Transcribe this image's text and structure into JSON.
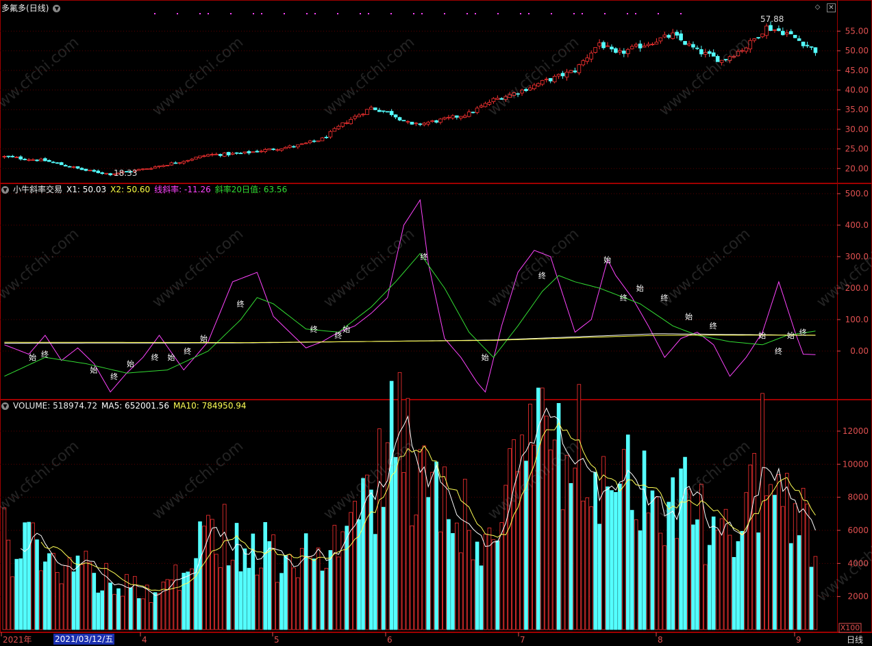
{
  "app": {
    "stock_title": "多氟多",
    "period": "(日线)",
    "period_bottom": "日线",
    "vol_unit": "X100"
  },
  "colors": {
    "background": "#000000",
    "up": "#ff3333",
    "down": "#54ffff",
    "grid": "#5a0000",
    "border": "#a00000",
    "axis_text": "#e05050",
    "ma5": "#ffffff",
    "ma10": "#ffff55",
    "slope_line": "#ff44ff",
    "slope_ma20": "#33dd33",
    "x1_line": "#ffffff",
    "x2_line": "#ffff44",
    "signal_marks": "#ff44ff"
  },
  "panels": {
    "price": {
      "high_label": "57.88",
      "low_label": "18.33",
      "yticks": [
        "55.00",
        "50.00",
        "45.00",
        "40.00",
        "35.00",
        "30.00",
        "25.00",
        "20.00"
      ]
    },
    "indicator": {
      "name": "小牛斜率交易",
      "x1_label": "X1: 50.03",
      "x2_label": "X2: 50.60",
      "slope_label": "线斜率: -11.26",
      "ma20_label": "斜率20日值: 63.56",
      "yticks": [
        "500.0",
        "400.0",
        "300.0",
        "200.0",
        "100.0",
        "0.00"
      ],
      "start_label": "始",
      "end_label": "终"
    },
    "volume": {
      "vol_label": "VOLUME: 518974.72",
      "ma5_label": "MA5: 652001.56",
      "ma10_label": "MA10: 784950.94",
      "yticks": [
        "12000",
        "10000",
        "8000",
        "6000",
        "4000",
        "2000"
      ]
    }
  },
  "x_axis": {
    "labels": [
      "2021年",
      "4",
      "5",
      "6",
      "7",
      "8",
      "9"
    ],
    "selected_date": "2021/03/12/五"
  },
  "watermark": "www.cfchi.com",
  "chart_data": [
    {
      "type": "candlestick",
      "title": "多氟多(日线)",
      "ylim": [
        17,
        58
      ],
      "x_range": [
        "2021-03",
        "2021-09"
      ],
      "price_keypoints": [
        {
          "bar": 0,
          "close": 23.0
        },
        {
          "bar": 10,
          "close": 22.0
        },
        {
          "bar": 20,
          "close": 19.5
        },
        {
          "bar": 26,
          "close": 18.6
        },
        {
          "bar": 34,
          "close": 19.8
        },
        {
          "bar": 42,
          "close": 21.5
        },
        {
          "bar": 50,
          "close": 23.5
        },
        {
          "bar": 58,
          "close": 23.8
        },
        {
          "bar": 66,
          "close": 25.0
        },
        {
          "bar": 72,
          "close": 25.8
        },
        {
          "bar": 78,
          "close": 27.5
        },
        {
          "bar": 84,
          "close": 32.0
        },
        {
          "bar": 90,
          "close": 35.5
        },
        {
          "bar": 95,
          "close": 34.0
        },
        {
          "bar": 100,
          "close": 31.0
        },
        {
          "bar": 108,
          "close": 32.5
        },
        {
          "bar": 114,
          "close": 34.0
        },
        {
          "bar": 120,
          "close": 37.5
        },
        {
          "bar": 126,
          "close": 39.5
        },
        {
          "bar": 132,
          "close": 42.0
        },
        {
          "bar": 140,
          "close": 45.0
        },
        {
          "bar": 146,
          "close": 52.0
        },
        {
          "bar": 150,
          "close": 49.0
        },
        {
          "bar": 158,
          "close": 52.0
        },
        {
          "bar": 164,
          "close": 54.0
        },
        {
          "bar": 170,
          "close": 50.0
        },
        {
          "bar": 176,
          "close": 47.5
        },
        {
          "bar": 182,
          "close": 51.0
        },
        {
          "bar": 187,
          "close": 56.0
        },
        {
          "bar": 192,
          "close": 54.5
        },
        {
          "bar": 196,
          "close": 52.0
        },
        {
          "bar": 199,
          "close": 50.0
        }
      ],
      "highest": 57.88,
      "lowest": 18.33
    },
    {
      "type": "line",
      "title": "小牛斜率交易",
      "ylim": [
        -150,
        520
      ],
      "series": [
        {
          "name": "线斜率",
          "color": "#ff44ff",
          "keypoints": [
            [
              0,
              20
            ],
            [
              6,
              -10
            ],
            [
              10,
              50
            ],
            [
              14,
              -30
            ],
            [
              18,
              10
            ],
            [
              22,
              -40
            ],
            [
              26,
              -130
            ],
            [
              30,
              -70
            ],
            [
              34,
              -20
            ],
            [
              38,
              50
            ],
            [
              44,
              -60
            ],
            [
              50,
              30
            ],
            [
              56,
              220
            ],
            [
              62,
              250
            ],
            [
              66,
              110
            ],
            [
              70,
              60
            ],
            [
              74,
              10
            ],
            [
              78,
              30
            ],
            [
              82,
              60
            ],
            [
              86,
              80
            ],
            [
              90,
              120
            ],
            [
              94,
              170
            ],
            [
              98,
              400
            ],
            [
              102,
              480
            ],
            [
              104,
              280
            ],
            [
              108,
              40
            ],
            [
              112,
              -20
            ],
            [
              116,
              -100
            ],
            [
              118,
              -130
            ],
            [
              122,
              80
            ],
            [
              126,
              250
            ],
            [
              130,
              320
            ],
            [
              134,
              300
            ],
            [
              136,
              220
            ],
            [
              140,
              60
            ],
            [
              144,
              100
            ],
            [
              148,
              290
            ],
            [
              150,
              240
            ],
            [
              154,
              170
            ],
            [
              158,
              80
            ],
            [
              162,
              -20
            ],
            [
              166,
              40
            ],
            [
              170,
              60
            ],
            [
              174,
              20
            ],
            [
              178,
              -80
            ],
            [
              182,
              -20
            ],
            [
              186,
              60
            ],
            [
              190,
              220
            ],
            [
              194,
              60
            ],
            [
              196,
              -10
            ],
            [
              199,
              -11.26
            ]
          ]
        },
        {
          "name": "斜率20日值",
          "color": "#33dd33",
          "keypoints": [
            [
              0,
              -80
            ],
            [
              10,
              -20
            ],
            [
              20,
              -40
            ],
            [
              30,
              -70
            ],
            [
              40,
              -60
            ],
            [
              50,
              0
            ],
            [
              58,
              100
            ],
            [
              62,
              170
            ],
            [
              66,
              150
            ],
            [
              74,
              70
            ],
            [
              82,
              60
            ],
            [
              90,
              140
            ],
            [
              96,
              220
            ],
            [
              102,
              310
            ],
            [
              108,
              200
            ],
            [
              114,
              60
            ],
            [
              120,
              -20
            ],
            [
              126,
              80
            ],
            [
              132,
              190
            ],
            [
              136,
              240
            ],
            [
              140,
              220
            ],
            [
              146,
              200
            ],
            [
              150,
              180
            ],
            [
              156,
              150
            ],
            [
              164,
              80
            ],
            [
              170,
              50
            ],
            [
              178,
              30
            ],
            [
              186,
              20
            ],
            [
              192,
              50
            ],
            [
              199,
              63.56
            ]
          ]
        },
        {
          "name": "X1",
          "color": "#ffffff",
          "keypoints": [
            [
              0,
              25
            ],
            [
              60,
              26
            ],
            [
              120,
              35
            ],
            [
              160,
              55
            ],
            [
              199,
              50.03
            ]
          ]
        },
        {
          "name": "X2",
          "color": "#ffff44",
          "keypoints": [
            [
              0,
              28
            ],
            [
              60,
              27
            ],
            [
              120,
              34
            ],
            [
              160,
              50
            ],
            [
              199,
              50.6
            ]
          ]
        }
      ],
      "signal_marks": [
        {
          "bar": 7,
          "text": "始",
          "value": -20
        },
        {
          "bar": 10,
          "text": "终",
          "value": -10
        },
        {
          "bar": 22,
          "text": "始",
          "value": -60
        },
        {
          "bar": 27,
          "text": "终",
          "value": -80
        },
        {
          "bar": 31,
          "text": "始",
          "value": -40
        },
        {
          "bar": 37,
          "text": "终",
          "value": -20
        },
        {
          "bar": 41,
          "text": "始",
          "value": -20
        },
        {
          "bar": 45,
          "text": "终",
          "value": 0
        },
        {
          "bar": 49,
          "text": "始",
          "value": 40
        },
        {
          "bar": 58,
          "text": "终",
          "value": 150
        },
        {
          "bar": 76,
          "text": "终",
          "value": 70
        },
        {
          "bar": 82,
          "text": "终",
          "value": 50
        },
        {
          "bar": 84,
          "text": "始",
          "value": 70
        },
        {
          "bar": 103,
          "text": "终",
          "value": 300
        },
        {
          "bar": 118,
          "text": "始",
          "value": -20
        },
        {
          "bar": 132,
          "text": "终",
          "value": 240
        },
        {
          "bar": 148,
          "text": "始",
          "value": 290
        },
        {
          "bar": 152,
          "text": "终",
          "value": 170
        },
        {
          "bar": 156,
          "text": "始",
          "value": 200
        },
        {
          "bar": 162,
          "text": "终",
          "value": 170
        },
        {
          "bar": 168,
          "text": "始",
          "value": 110
        },
        {
          "bar": 174,
          "text": "终",
          "value": 80
        },
        {
          "bar": 186,
          "text": "始",
          "value": 50
        },
        {
          "bar": 190,
          "text": "终",
          "value": 0
        },
        {
          "bar": 193,
          "text": "始",
          "value": 50
        },
        {
          "bar": 196,
          "text": "终",
          "value": 60
        }
      ]
    },
    {
      "type": "bar",
      "title": "VOLUME",
      "ylim": [
        0,
        13000
      ],
      "unit_multiplier": 100,
      "volume_keypoints": [
        [
          0,
          5500
        ],
        [
          10,
          4300
        ],
        [
          20,
          3800
        ],
        [
          30,
          2700
        ],
        [
          36,
          2200
        ],
        [
          44,
          3600
        ],
        [
          50,
          5300
        ],
        [
          56,
          5800
        ],
        [
          62,
          5200
        ],
        [
          68,
          4300
        ],
        [
          74,
          4600
        ],
        [
          80,
          5000
        ],
        [
          86,
          5700
        ],
        [
          88,
          8800
        ],
        [
          92,
          9800
        ],
        [
          96,
          12500
        ],
        [
          100,
          9200
        ],
        [
          106,
          8000
        ],
        [
          112,
          7200
        ],
        [
          118,
          6000
        ],
        [
          122,
          9000
        ],
        [
          128,
          10400
        ],
        [
          134,
          11000
        ],
        [
          138,
          11800
        ],
        [
          144,
          10500
        ],
        [
          150,
          9800
        ],
        [
          156,
          8000
        ],
        [
          162,
          7200
        ],
        [
          168,
          7600
        ],
        [
          172,
          6200
        ],
        [
          176,
          5200
        ],
        [
          182,
          6800
        ],
        [
          186,
          10500
        ],
        [
          188,
          9000
        ],
        [
          194,
          7200
        ],
        [
          199,
          5189.7
        ]
      ],
      "ma5_last": 6520.0,
      "ma10_last": 7849.5
    }
  ]
}
